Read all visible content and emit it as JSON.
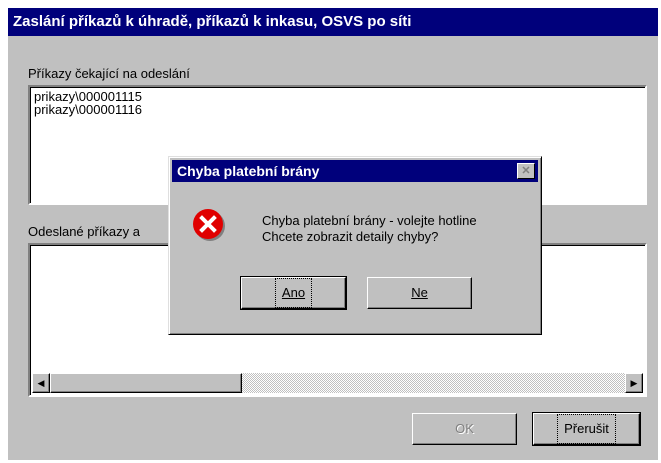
{
  "window": {
    "title": "Zaslání příkazů k úhradě, příkazů k inkasu, OSVS po síti",
    "pending_label": "Příkazy čekající na odeslání",
    "pending_items": [
      "prikazy\\000001115",
      "prikazy\\000001116"
    ],
    "sent_label": "Odeslané příkazy a",
    "scroll_left": "◀",
    "scroll_right": "▶",
    "ok_label": "OK",
    "cancel_label": "Přerušit"
  },
  "dialog": {
    "title": "Chyba platební brány",
    "close_glyph": "✕",
    "message_line1": "Chyba platební brány - volejte hotline",
    "message_line2": "Chcete zobrazit detaily chyby?",
    "yes_label": "Ano",
    "no_label": "Ne",
    "icon": "error-icon"
  },
  "colors": {
    "titlebar": "#00007b",
    "face": "#c0c0c0",
    "error_red": "#e00000"
  }
}
